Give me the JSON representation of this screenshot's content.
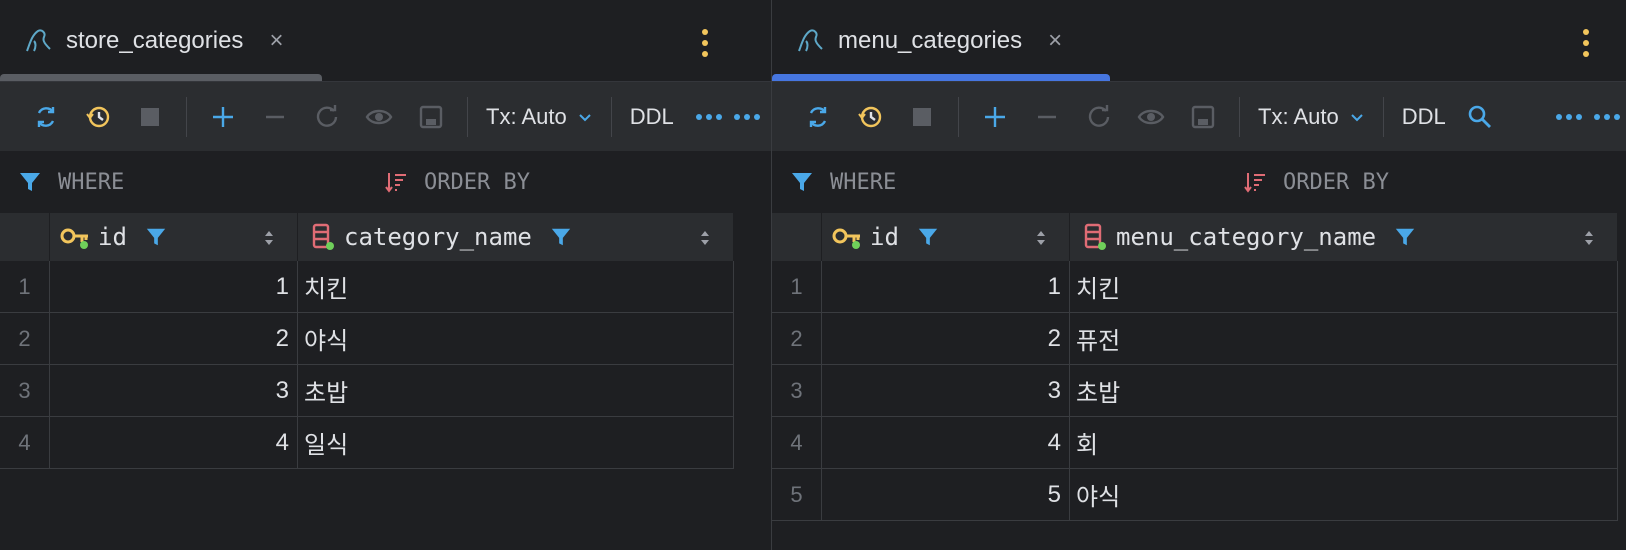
{
  "colors": {
    "background": "#1e1f22",
    "toolbar": "#2b2d30",
    "accent_blue": "#4aa8e8",
    "tab_indicator_active": "#4676e0",
    "tab_indicator_inactive": "#5a5d63",
    "key_icon": "#f2c55c",
    "column_icon": "#e06c75",
    "filter_icon": "#4aa8e8",
    "kebab": "#f2c55c"
  },
  "left": {
    "tab_title": "store_categories",
    "tab_close": "×",
    "tx_label": "Tx: Auto",
    "ddl_label": "DDL",
    "where_label": "WHERE",
    "orderby_label": "ORDER BY",
    "columns": [
      "id",
      "category_name"
    ],
    "rows": [
      {
        "n": "1",
        "id": "1",
        "name": "치킨"
      },
      {
        "n": "2",
        "id": "2",
        "name": "야식"
      },
      {
        "n": "3",
        "id": "3",
        "name": "초밥"
      },
      {
        "n": "4",
        "id": "4",
        "name": "일식"
      }
    ]
  },
  "right": {
    "tab_title": "menu_categories",
    "tab_close": "×",
    "tx_label": "Tx: Auto",
    "ddl_label": "DDL",
    "where_label": "WHERE",
    "orderby_label": "ORDER BY",
    "columns": [
      "id",
      "menu_category_name"
    ],
    "rows": [
      {
        "n": "1",
        "id": "1",
        "name": "치킨"
      },
      {
        "n": "2",
        "id": "2",
        "name": "퓨전"
      },
      {
        "n": "3",
        "id": "3",
        "name": "초밥"
      },
      {
        "n": "4",
        "id": "4",
        "name": "회"
      },
      {
        "n": "5",
        "id": "5",
        "name": "야식"
      }
    ]
  }
}
